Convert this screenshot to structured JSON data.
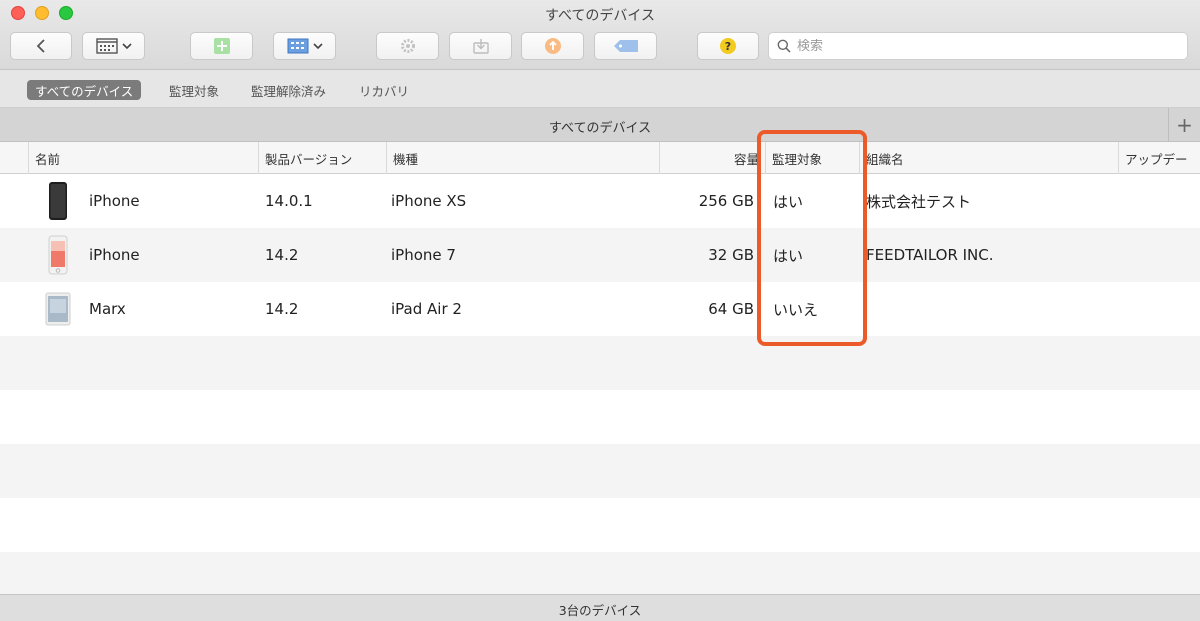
{
  "window": {
    "title": "すべてのデバイス"
  },
  "toolbar": {
    "search_placeholder": "検索",
    "icons": [
      "chevron-left-icon",
      "calendar-view-icon",
      "add-icon",
      "grid-view-icon",
      "gear-icon",
      "download-icon",
      "upload-icon",
      "tag-icon",
      "help-icon"
    ]
  },
  "scope": {
    "tabs": [
      {
        "label": "すべてのデバイス",
        "active": true
      },
      {
        "label": "監理対象",
        "active": false
      },
      {
        "label": "監理解除済み",
        "active": false
      },
      {
        "label": "リカバリ",
        "active": false
      }
    ]
  },
  "group": {
    "title": "すべてのデバイス"
  },
  "table": {
    "columns": [
      "名前",
      "製品バージョン",
      "機種",
      "容量",
      "監理対象",
      "組織名",
      "アップデー"
    ],
    "rows": [
      {
        "name": "iPhone",
        "version": "14.0.1",
        "model": "iPhone XS",
        "capacity": "256 GB",
        "supervised": "はい",
        "org": "株式会社テスト",
        "thumb": "iphone-xs-thumbnail"
      },
      {
        "name": "iPhone",
        "version": "14.2",
        "model": "iPhone 7",
        "capacity": "32 GB",
        "supervised": "はい",
        "org": "FEEDTAILOR INC.",
        "thumb": "iphone-7-thumbnail"
      },
      {
        "name": "Marx",
        "version": "14.2",
        "model": "iPad Air 2",
        "capacity": "64 GB",
        "supervised": "いいえ",
        "org": "",
        "thumb": "ipad-air-thumbnail"
      }
    ]
  },
  "status": {
    "text": "3台のデバイス"
  },
  "colors": {
    "highlight": "#ec5a2a",
    "active_tab": "#7b7b7b"
  }
}
